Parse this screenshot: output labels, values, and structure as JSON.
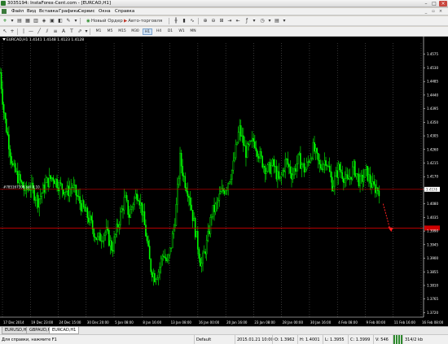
{
  "window": {
    "title": "3035194: InstaForex-Cent.com - [EURCAD,H1]"
  },
  "menu": [
    "Файл",
    "Вид",
    "Вставка",
    "Графики",
    "Сервис",
    "Окна",
    "Справка"
  ],
  "toolbar": {
    "new_order": "Новый Ордер",
    "autotrade": "Авто-торговля",
    "timeframes": [
      "M1",
      "M5",
      "M15",
      "M30",
      "H1",
      "H4",
      "D1",
      "W1",
      "MN"
    ]
  },
  "chart": {
    "symbol_line": "EURCAD,H1  1.4141 1.4148 1.4123 1.4128",
    "order_label": "#78516710B sell 0.10",
    "current_price": "1.4128",
    "order_price": "1.4128"
  },
  "colors": {
    "background": "#000000",
    "candle": "#00ff00",
    "grid": "#6b6b6b",
    "level_line": "#d00000",
    "price_text": "#ffffff"
  },
  "chart_data": {
    "type": "candlestick",
    "symbol": "EURCAD",
    "timeframe": "H1",
    "price_axis": [
      "1.4575",
      "1.4530",
      "1.4485",
      "1.4440",
      "1.4395",
      "1.4350",
      "1.4305",
      "1.4260",
      "1.4215",
      "1.4170",
      "1.4128",
      "1.4080",
      "1.4035",
      "1.3990",
      "1.3945",
      "1.3900",
      "1.3855",
      "1.3810",
      "1.3765",
      "1.3720"
    ],
    "price_range": [
      1.3705,
      1.4612
    ],
    "time_axis": [
      "17 Dec 2014",
      "19 Dec 23:00",
      "24 Dec 15:00",
      "30 Dec 20:00",
      "5 Jan 08:00",
      "8 Jan 16:00",
      "13 Jan 08:00",
      "16 Jan 00:00",
      "20 Jan 16:00",
      "23 Jan 08:00",
      "28 Jan 00:00",
      "30 Jan 16:00",
      "4 Feb 08:00",
      "9 Feb 00:00",
      "11 Feb 16:00",
      "16 Feb 08:00"
    ],
    "close_path": [
      [
        0,
        1.4515
      ],
      [
        0.01,
        1.437
      ],
      [
        0.02,
        1.429
      ],
      [
        0.03,
        1.42
      ],
      [
        0.045,
        1.416
      ],
      [
        0.06,
        1.412
      ],
      [
        0.07,
        1.414
      ],
      [
        0.09,
        1.409
      ],
      [
        0.11,
        1.415
      ],
      [
        0.125,
        1.417
      ],
      [
        0.14,
        1.414
      ],
      [
        0.16,
        1.412
      ],
      [
        0.17,
        1.414
      ],
      [
        0.19,
        1.408
      ],
      [
        0.21,
        1.403
      ],
      [
        0.23,
        1.396
      ],
      [
        0.25,
        1.399
      ],
      [
        0.265,
        1.393
      ],
      [
        0.28,
        1.402
      ],
      [
        0.295,
        1.41
      ],
      [
        0.305,
        1.404
      ],
      [
        0.315,
        1.409
      ],
      [
        0.325,
        1.412
      ],
      [
        0.335,
        1.406
      ],
      [
        0.345,
        1.3975
      ],
      [
        0.355,
        1.387
      ],
      [
        0.365,
        1.384
      ],
      [
        0.375,
        1.386
      ],
      [
        0.385,
        1.392
      ],
      [
        0.395,
        1.388
      ],
      [
        0.405,
        1.395
      ],
      [
        0.415,
        1.405
      ],
      [
        0.425,
        1.423
      ],
      [
        0.435,
        1.416
      ],
      [
        0.445,
        1.412
      ],
      [
        0.46,
        1.4
      ],
      [
        0.475,
        1.3875
      ],
      [
        0.49,
        1.396
      ],
      [
        0.5,
        1.405
      ],
      [
        0.51,
        1.407
      ],
      [
        0.52,
        1.411
      ],
      [
        0.535,
        1.414
      ],
      [
        0.55,
        1.42
      ],
      [
        0.565,
        1.433
      ],
      [
        0.58,
        1.425
      ],
      [
        0.6,
        1.429
      ],
      [
        0.615,
        1.423
      ],
      [
        0.63,
        1.419
      ],
      [
        0.645,
        1.421
      ],
      [
        0.66,
        1.415
      ],
      [
        0.675,
        1.4225
      ],
      [
        0.69,
        1.4175
      ],
      [
        0.705,
        1.423
      ],
      [
        0.72,
        1.419
      ],
      [
        0.74,
        1.4265
      ],
      [
        0.755,
        1.42
      ],
      [
        0.77,
        1.423
      ],
      [
        0.785,
        1.414
      ],
      [
        0.8,
        1.42
      ],
      [
        0.82,
        1.415
      ],
      [
        0.835,
        1.42
      ],
      [
        0.85,
        1.415
      ],
      [
        0.865,
        1.4185
      ],
      [
        0.88,
        1.4135
      ],
      [
        0.895,
        1.4128
      ]
    ],
    "horizontal_levels": [
      1.4128,
      1.4
    ],
    "projection_arrow": {
      "from": 1.408,
      "to": 1.399
    }
  },
  "chart_tabs": [
    "EURUSD,H1",
    "GBPAUD,H1",
    "EURCAD,H1"
  ],
  "status": {
    "help": "Для справки, нажмите F1",
    "profile": "Default",
    "datetime": "2015.01.21 10:00",
    "open": "O: 1.3962",
    "high": "H: 1.4001",
    "low": "L: 1.3955",
    "close": "C: 1.3999",
    "volume": "V: 546",
    "traffic": "314/2 kb"
  }
}
